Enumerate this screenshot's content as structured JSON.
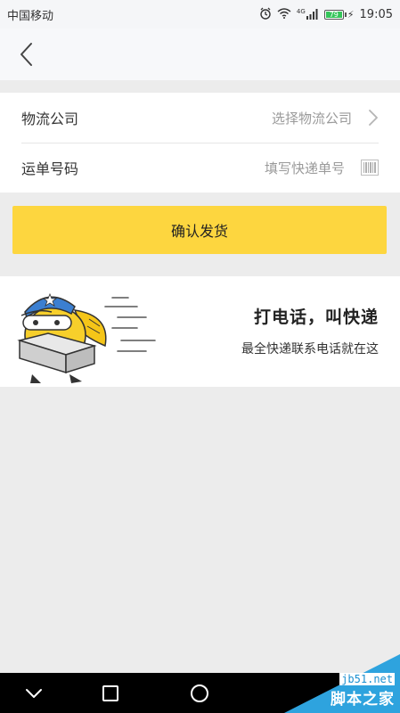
{
  "status_bar": {
    "carrier": "中国移动",
    "network": "4G",
    "battery": "79",
    "time": "19:05"
  },
  "header": {
    "back_icon": "chevron-left-icon"
  },
  "form": {
    "company": {
      "label": "物流公司",
      "placeholder": "选择物流公司",
      "icon": "chevron-right-icon"
    },
    "tracking": {
      "label": "运单号码",
      "placeholder": "填写快递单号",
      "icon": "barcode-icon"
    }
  },
  "confirm_button": {
    "label": "确认发货",
    "color": "#fdd63f"
  },
  "banner": {
    "title": "打电话，叫快递",
    "subtitle": "最全快递联系电话就在这"
  },
  "nav_bar": {
    "icons": [
      "back-chevron-down-icon",
      "recent-square-icon",
      "home-circle-icon"
    ]
  },
  "watermark": {
    "site": "jb51.net",
    "name": "脚本之家"
  }
}
